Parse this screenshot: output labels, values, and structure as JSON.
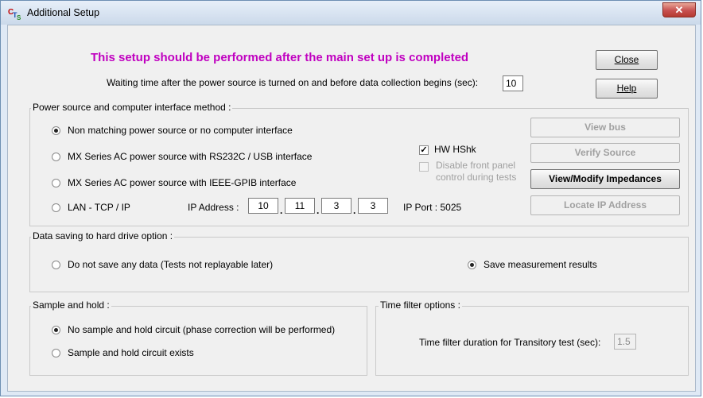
{
  "window": {
    "title": "Additional Setup",
    "close_glyph": "✕",
    "app_icon": "cts-app-icon"
  },
  "header": {
    "notice": "This setup should be performed after the main set up is completed",
    "wait_label": "Waiting time after the power source is turned on and before data collection begins (sec):",
    "wait_value": "10"
  },
  "buttons": {
    "close": "Close",
    "help": "Help",
    "view_bus": "View bus",
    "verify_source": "Verify Source",
    "view_modify_impedances": "View/Modify Impedances",
    "locate_ip": "Locate IP Address"
  },
  "power_group": {
    "title": "Power source and computer interface method :",
    "options": [
      {
        "label": "Non matching power source or  no computer interface",
        "selected": true
      },
      {
        "label": "MX Series AC power source with RS232C / USB interface",
        "selected": false
      },
      {
        "label": "MX Series AC power source with IEEE-GPIB interface",
        "selected": false
      },
      {
        "label": "LAN - TCP / IP",
        "selected": false
      }
    ],
    "ip_label": "IP Address :",
    "ip_octets": [
      "10",
      "11",
      "3",
      "3"
    ],
    "ip_port": "IP Port : 5025",
    "hw_hshk": {
      "label": "HW HShk",
      "checked": true
    },
    "disable_front_panel": {
      "label_line1": "Disable front panel",
      "label_line2": "control during tests",
      "checked": false,
      "enabled": false
    }
  },
  "data_group": {
    "title": "Data saving to hard drive option :",
    "options": [
      {
        "label": "Do not save any data (Tests not replayable later)",
        "selected": false
      },
      {
        "label": "Save measurement results",
        "selected": true
      }
    ]
  },
  "sample_group": {
    "title": "Sample and hold :",
    "options": [
      {
        "label": "No sample and hold circuit (phase correction will be performed)",
        "selected": true
      },
      {
        "label": "Sample and hold circuit exists",
        "selected": false
      }
    ]
  },
  "time_group": {
    "title": "Time filter options :",
    "duration_label": "Time filter duration for Transitory test (sec):",
    "duration_value": "1.5"
  }
}
